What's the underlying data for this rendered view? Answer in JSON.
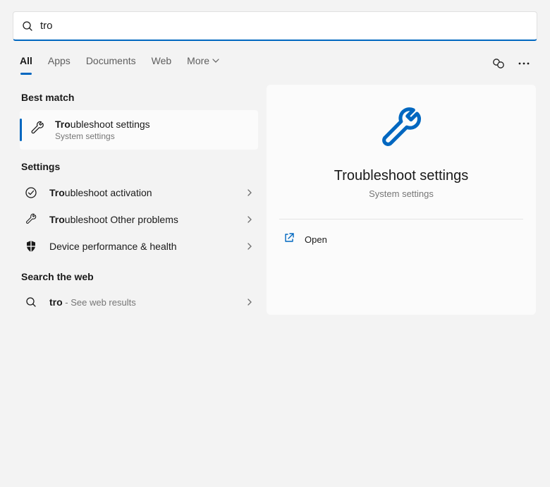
{
  "search": {
    "value": "tro"
  },
  "tabs": {
    "all": "All",
    "apps": "Apps",
    "documents": "Documents",
    "web": "Web",
    "more": "More"
  },
  "sections": {
    "bestmatch": "Best match",
    "settings": "Settings",
    "searchweb": "Search the web"
  },
  "bestmatch": {
    "prefix": "Tro",
    "rest": "ubleshoot settings",
    "sub": "System settings"
  },
  "settingsItems": [
    {
      "prefix": "Tro",
      "rest": "ubleshoot activation",
      "icon": "check"
    },
    {
      "prefix": "Tro",
      "rest": "ubleshoot Other problems",
      "icon": "wrench"
    },
    {
      "prefix": "",
      "rest": "Device performance & health",
      "icon": "shield"
    }
  ],
  "webItem": {
    "prefix": "tro",
    "suffix": " - See web results"
  },
  "preview": {
    "title": "Troubleshoot settings",
    "sub": "System settings",
    "action": "Open"
  }
}
